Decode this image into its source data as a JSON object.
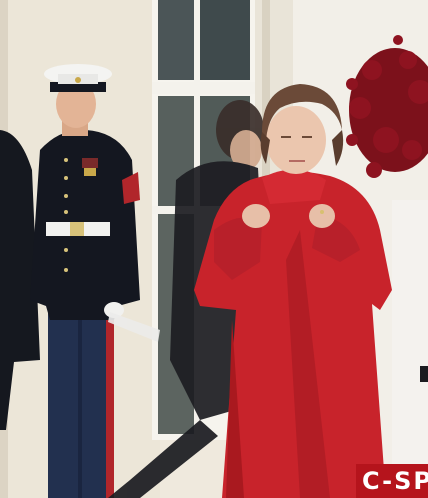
{
  "photo": {
    "scene": "outdoor-porch",
    "colors": {
      "wall": "#f0ece2",
      "coat": "#c8232b",
      "uniform": "#141720",
      "hat": "#f4f4f2",
      "garland": "#8e1320"
    }
  },
  "logo": {
    "text": "C-SP",
    "color": "#b5141c"
  }
}
